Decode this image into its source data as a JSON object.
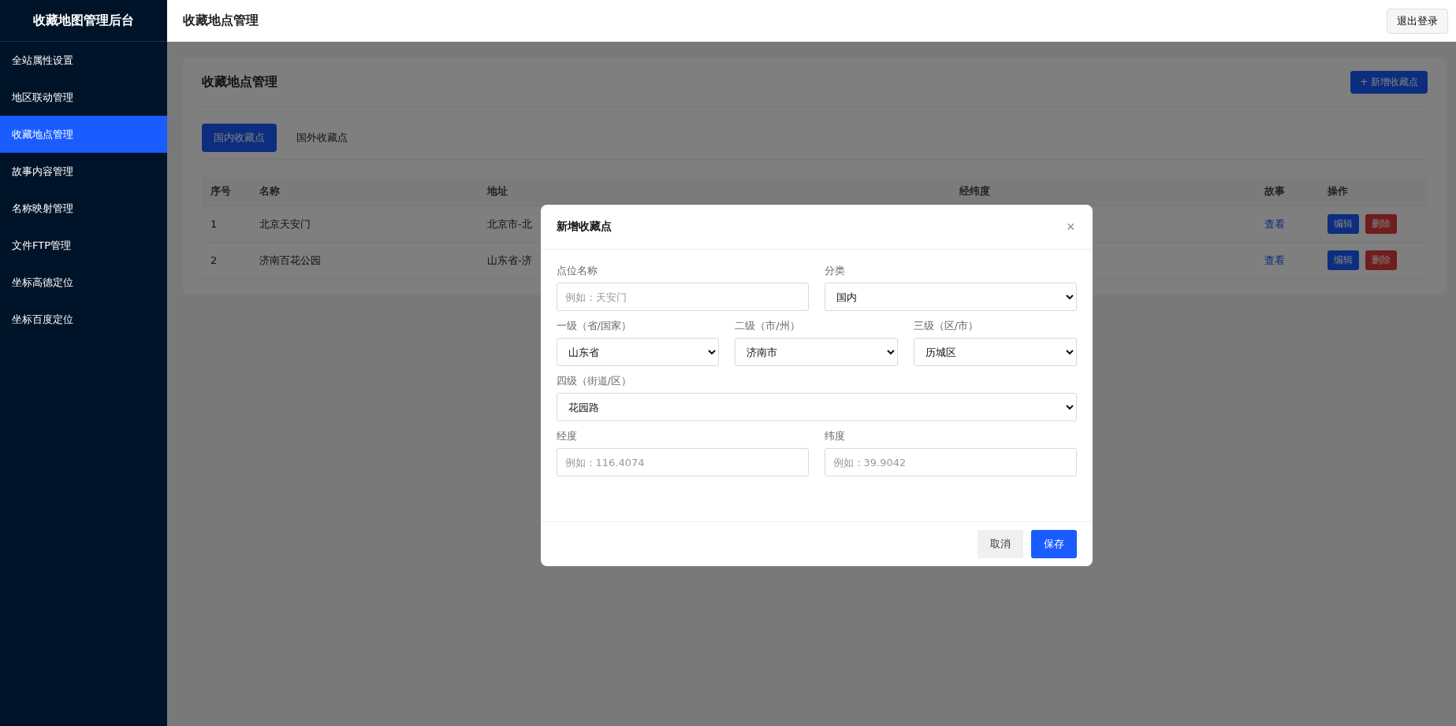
{
  "sidebar": {
    "brand": "收藏地图管理后台",
    "items": [
      {
        "label": "全站属性设置",
        "selected": false
      },
      {
        "label": "地区联动管理",
        "selected": false
      },
      {
        "label": "收藏地点管理",
        "selected": true
      },
      {
        "label": "故事内容管理",
        "selected": false
      },
      {
        "label": "名称映射管理",
        "selected": false
      },
      {
        "label": "文件FTP管理",
        "selected": false
      },
      {
        "label": "坐标高德定位",
        "selected": false
      },
      {
        "label": "坐标百度定位",
        "selected": false
      }
    ]
  },
  "header": {
    "title": "收藏地点管理",
    "logout_button": "退出登录"
  },
  "card": {
    "title": "收藏地点管理",
    "add_button": "+ 新增收藏点",
    "tabs": [
      {
        "label": "国内收藏点",
        "selected": true
      },
      {
        "label": "国外收藏点",
        "selected": false
      }
    ],
    "table": {
      "columns": [
        "序号",
        "名称",
        "地址",
        "经纬度",
        "故事",
        "操作"
      ],
      "rows": [
        {
          "index": "1",
          "name": "北京天安门",
          "address": "北京市-北",
          "story": "查看",
          "actions": [
            "编辑",
            "删除"
          ]
        },
        {
          "index": "2",
          "name": "济南百花公园",
          "address": "山东省-济",
          "story": "查看",
          "actions": [
            "编辑",
            "删除"
          ]
        }
      ]
    }
  },
  "dialog": {
    "title": "新增收藏点",
    "close": "×",
    "rows": [
      [
        {
          "kind": "input",
          "label": "点位名称",
          "placeholder": "例如：天安门"
        },
        {
          "kind": "select",
          "label": "分类",
          "value": "国内"
        }
      ],
      [
        {
          "kind": "select",
          "label": "一级（省/国家）",
          "value": "山东省"
        },
        {
          "kind": "select",
          "label": "二级（市/州）",
          "value": "济南市"
        },
        {
          "kind": "select",
          "label": "三级（区/市）",
          "value": "历城区"
        }
      ],
      [
        {
          "kind": "select",
          "label": "四级（街道/区）",
          "value": "花园路"
        }
      ],
      [
        {
          "kind": "input",
          "label": "经度",
          "placeholder": "例如：116.4074"
        },
        {
          "kind": "input",
          "label": "纬度",
          "placeholder": "例如：39.9042"
        }
      ]
    ],
    "cancel_button": "取消",
    "save_button": "保存"
  }
}
